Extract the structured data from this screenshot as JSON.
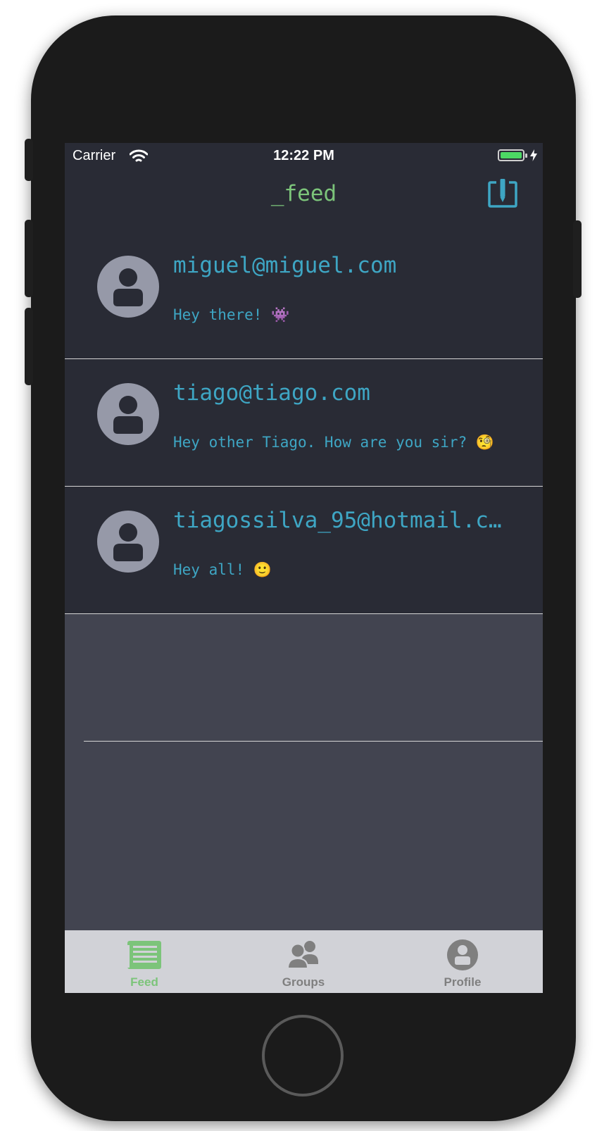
{
  "status_bar": {
    "carrier": "Carrier",
    "time": "12:22 PM",
    "battery_color": "#4cd964"
  },
  "nav": {
    "title": "_feed",
    "title_color": "#7cc47a",
    "compose_icon": "compose-icon"
  },
  "feed": {
    "accent_color": "#3ea6c4",
    "items": [
      {
        "email": "miguel@miguel.com",
        "message": "Hey there! 👾"
      },
      {
        "email": "tiago@tiago.com",
        "message": "Hey other Tiago. How are you sir? 🧐"
      },
      {
        "email": "tiagossilva_95@hotmail.c…",
        "message": "Hey all! 🙂"
      }
    ]
  },
  "tabs": [
    {
      "label": "Feed",
      "icon": "newspaper-icon",
      "active": true,
      "color": "#7cc47a"
    },
    {
      "label": "Groups",
      "icon": "group-icon",
      "active": false,
      "color": "#7f7f7f"
    },
    {
      "label": "Profile",
      "icon": "profile-icon",
      "active": false,
      "color": "#7f7f7f"
    }
  ]
}
